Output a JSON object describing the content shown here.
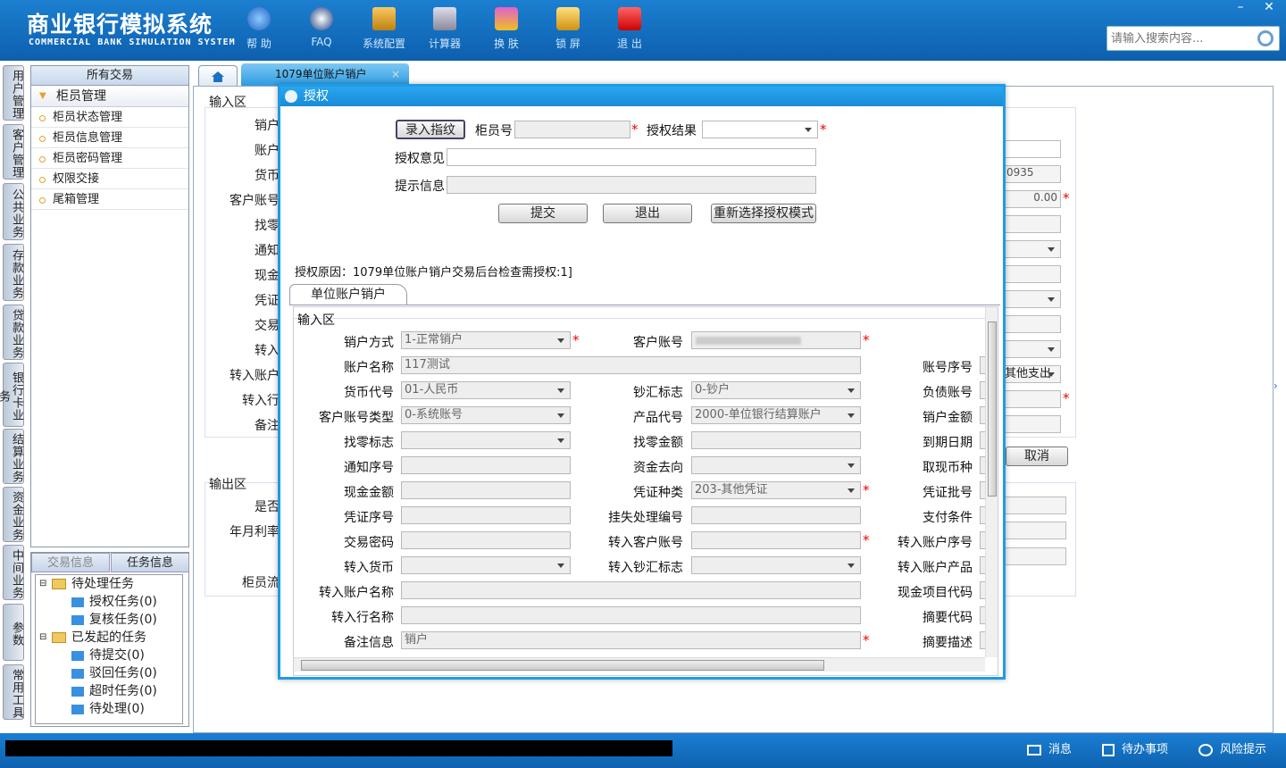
{
  "header": {
    "title_cn": "商业银行模拟系统",
    "title_en": "COMMERCIAL BANK SIMULATION SYSTEM",
    "toolbar": [
      {
        "label": "帮 助",
        "icon": "info-icon"
      },
      {
        "label": "FAQ",
        "icon": "question-icon"
      },
      {
        "label": "系统配置",
        "icon": "toolbox-icon"
      },
      {
        "label": "计算器",
        "icon": "calculator-icon"
      },
      {
        "label": "换 肤",
        "icon": "tshirt-icon"
      },
      {
        "label": "锁 屏",
        "icon": "lock-icon"
      },
      {
        "label": "退 出",
        "icon": "power-icon"
      }
    ],
    "search_placeholder": "请输入搜索内容..."
  },
  "window": {
    "minimize": "–",
    "close": "✕"
  },
  "vtabs": [
    "用户管理",
    "客户管理",
    "公共业务",
    "存款业务",
    "贷款业务",
    "银行卡业务",
    "结算业务",
    "资金业务",
    "中间业务",
    "参数",
    "常用工具"
  ],
  "left": {
    "header": "所有交易",
    "group": "柜员管理",
    "items": [
      "柜员状态管理",
      "柜员信息管理",
      "柜员密码管理",
      "权限交接",
      "尾箱管理"
    ]
  },
  "tasks": {
    "tabs": [
      "交易信息",
      "任务信息"
    ],
    "pending": "待处理任务",
    "pending_children": [
      "授权任务(0)",
      "复核任务(0)"
    ],
    "started": "已发起的任务",
    "started_children": [
      "待提交(0)",
      "驳回任务(0)",
      "超时任务(0)",
      "待处理(0)"
    ]
  },
  "main": {
    "tab": "1079单位账户销户",
    "tab_close": "×",
    "bg_labels": [
      "输入区",
      "销户",
      "账户",
      "货币",
      "客户账号",
      "找零",
      "通知",
      "现金",
      "凭证",
      "交易",
      "转入",
      "转入账户",
      "转入行",
      "备注",
      "输出区",
      "是否",
      "年月利率",
      "柜员流"
    ],
    "bg_values": {
      "v1": "0935",
      "v2": "0.00",
      "v3": "其他支出",
      "cancel": "取消"
    }
  },
  "dialog": {
    "title": "授权",
    "enter_fp": "录入指纹",
    "teller_no": "柜员号",
    "auth_result": "授权结果",
    "auth_opinion": "授权意见",
    "prompt_info": "提示信息",
    "submit": "提交",
    "exit": "退出",
    "reselect": "重新选择授权模式",
    "reason": "授权原因：1079单位账户销户交易后台检查需授权:1]",
    "subtab": "单位账户销户",
    "input_area": "输入区",
    "fields": {
      "close_method": "销户方式",
      "close_method_v": "1-正常销户",
      "cust_acct": "客户账号",
      "acct_name": "账户名称",
      "acct_name_v": "117测试",
      "acct_seq": "账号序号",
      "currency": "货币代号",
      "currency_v": "01-人民币",
      "cash_flag": "钞汇标志",
      "cash_flag_v": "0-钞户",
      "liab_acct": "负债账号",
      "acct_type": "客户账号类型",
      "acct_type_v": "0-系统账号",
      "product": "产品代号",
      "product_v": "2000-单位银行结算账户",
      "close_amt": "销户金额",
      "change_flag": "找零标志",
      "change_amt": "找零金额",
      "due_date": "到期日期",
      "notice_no": "通知序号",
      "fund_dir": "资金去向",
      "withdraw_cur": "取现币种",
      "cash_amt": "现金金额",
      "voucher_type": "凭证种类",
      "voucher_type_v": "203-其他凭证",
      "voucher_batch": "凭证批号",
      "voucher_seq": "凭证序号",
      "loss_no": "挂失处理编号",
      "pay_cond": "支付条件",
      "trade_pwd": "交易密码",
      "in_acct": "转入客户账号",
      "in_acct_seq": "转入账户序号",
      "in_cur": "转入货币",
      "in_cash_flag": "转入钞汇标志",
      "in_product": "转入账户产品",
      "in_acct_name": "转入账户名称",
      "cash_item": "现金项目代码",
      "in_bank": "转入行名称",
      "summary_code": "摘要代码",
      "remark": "备注信息",
      "remark_v": "销户",
      "summary_desc": "摘要描述"
    }
  },
  "statusbar": {
    "msg": "消息",
    "todo": "待办事项",
    "risk": "风险提示"
  }
}
